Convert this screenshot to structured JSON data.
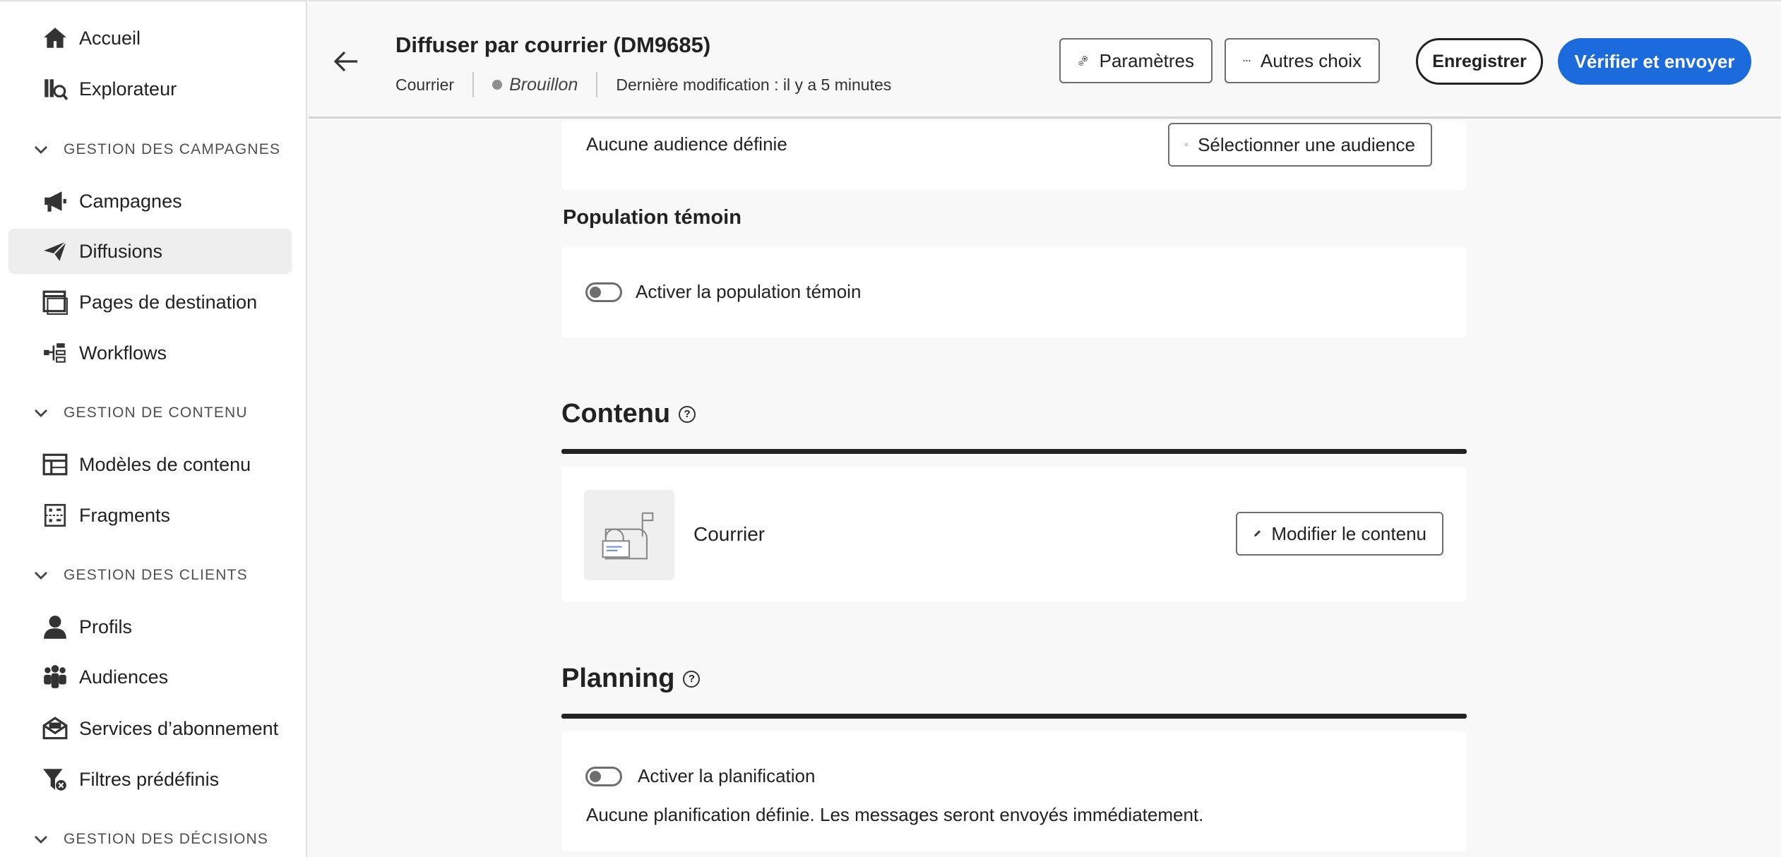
{
  "sidebar": {
    "top_items": [
      {
        "label": "Accueil",
        "icon": "home-icon"
      },
      {
        "label": "Explorateur",
        "icon": "explorer-icon"
      }
    ],
    "sections": [
      {
        "title": "GESTION DES CAMPAGNES",
        "items": [
          {
            "label": "Campagnes",
            "icon": "megaphone-icon"
          },
          {
            "label": "Diffusions",
            "icon": "send-icon",
            "active": true
          },
          {
            "label": "Pages de destination",
            "icon": "landing-page-icon"
          },
          {
            "label": "Workflows",
            "icon": "workflow-icon"
          }
        ]
      },
      {
        "title": "GESTION DE CONTENU",
        "items": [
          {
            "label": "Modèles de contenu",
            "icon": "template-icon"
          },
          {
            "label": "Fragments",
            "icon": "fragment-icon"
          }
        ]
      },
      {
        "title": "GESTION DES CLIENTS",
        "items": [
          {
            "label": "Profils",
            "icon": "user-icon"
          },
          {
            "label": "Audiences",
            "icon": "audiences-icon"
          },
          {
            "label": "Services d’abonnement",
            "icon": "subscription-icon"
          },
          {
            "label": "Filtres prédéfinis",
            "icon": "filter-icon"
          }
        ]
      },
      {
        "title": "GESTION DES DÉCISIONS",
        "items": []
      }
    ]
  },
  "header": {
    "title": "Diffuser par courrier (DM9685)",
    "channel": "Courrier",
    "status": "Brouillon",
    "last_modified": "Dernière modification : il y a 5 minutes",
    "buttons": {
      "settings": "Paramètres",
      "more": "Autres choix",
      "save": "Enregistrer",
      "review_send": "Vérifier et envoyer"
    }
  },
  "audience": {
    "empty_text": "Aucune audience définie",
    "select_button": "Sélectionner une audience"
  },
  "control_group": {
    "title": "Population témoin",
    "toggle_label": "Activer la population témoin",
    "enabled": false
  },
  "content": {
    "title": "Contenu",
    "item_label": "Courrier",
    "edit_button": "Modifier le contenu"
  },
  "schedule": {
    "title": "Planning",
    "toggle_label": "Activer la planification",
    "enabled": false,
    "info": "Aucune planification définie. Les messages seront envoyés immédiatement."
  },
  "colors": {
    "accent": "#1c6bdc",
    "sidebar_active": "#eeeeee",
    "background": "#f8f8f8"
  }
}
